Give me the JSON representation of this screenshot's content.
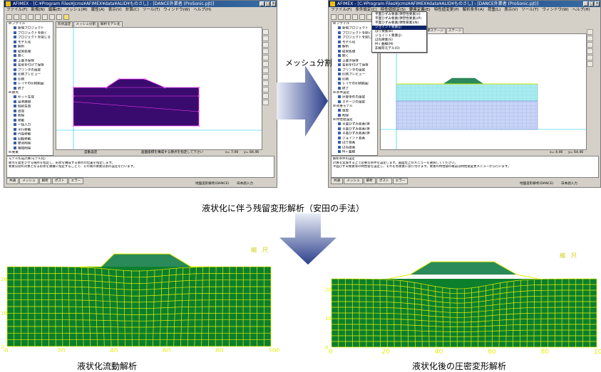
{
  "left_window": {
    "title": "AFIMEX - [C:¥Program Files¥Jcms¥AFIMEX¥data¥ALID¥ものさし] - [DANCE外業者 (ProSonic.pjt)]",
    "menu": [
      "ファイル(F)",
      "新規(N)",
      "編集(E)",
      "メッシュ(M)",
      "属性(A)",
      "表示(V)",
      "計算(C)",
      "ツール(T)",
      "ウィンドウ(W)",
      "ヘルプ(H)"
    ],
    "tabs": [
      "形状設定",
      "メッシュ分割",
      "解析モデル化"
    ],
    "tree": [
      {
        "type": "g",
        "label": "ファイル"
      },
      {
        "type": "it",
        "label": "新規プロジェクト"
      },
      {
        "type": "it",
        "label": "プロジェクトを開く"
      },
      {
        "type": "it",
        "label": "プロジェクトを閉じる"
      },
      {
        "type": "it",
        "label": "モデル化"
      },
      {
        "type": "it",
        "label": "解析"
      },
      {
        "type": "it",
        "label": "結果処理"
      },
      {
        "type": "it",
        "label": "開く"
      },
      {
        "type": "it",
        "label": "上書き保存"
      },
      {
        "type": "it",
        "label": "名前を付けて保存"
      },
      {
        "type": "it",
        "label": "プリンタの設定"
      },
      {
        "type": "it",
        "label": "印刷プレビュー"
      },
      {
        "type": "it",
        "label": "印刷"
      },
      {
        "type": "it",
        "label": "レイヤの印刷範囲"
      },
      {
        "type": "it",
        "label": "終了"
      },
      {
        "type": "g",
        "label": "節点"
      },
      {
        "type": "it",
        "label": "セット生成"
      },
      {
        "type": "it",
        "label": "基準座標"
      },
      {
        "type": "it",
        "label": "個別生成"
      },
      {
        "type": "it",
        "label": "追加"
      },
      {
        "type": "it",
        "label": "削除"
      },
      {
        "type": "it",
        "label": "移動"
      },
      {
        "type": "it",
        "label": "一括入力"
      },
      {
        "type": "it",
        "label": "平行移動"
      },
      {
        "type": "it",
        "label": "円弧移動"
      },
      {
        "type": "it",
        "label": "回転移動"
      },
      {
        "type": "it",
        "label": "節点削除"
      },
      {
        "type": "it",
        "label": "構成削除"
      },
      {
        "type": "g",
        "label": "要素"
      },
      {
        "type": "it",
        "label": "領域生成"
      },
      {
        "type": "it",
        "label": "規則要素"
      },
      {
        "type": "it",
        "label": "円弧生成"
      },
      {
        "type": "it",
        "label": "円弧削除"
      },
      {
        "type": "it",
        "label": "領域削除"
      },
      {
        "type": "it",
        "label": "要素削除"
      }
    ],
    "status_left": "自動設定",
    "status_center": "画面座標を構成する節点を指定して下さい",
    "status_x": "x= 7.06",
    "status_y": "y= 84.46",
    "messages": [
      "モデル作成計算(モデル化)",
      "節点を発生させる場所を指定し、形状を構成する節点の位置を指定します。",
      "要素分割の対象となる形状を順番に指定することで、その後の要素分割の設定を行います。"
    ],
    "bottom_tabs": [
      "共通",
      "メッシュ",
      "解析",
      "ポスト",
      "エラー"
    ],
    "footer_center": "地盤変形解析(DANCE)",
    "footer_right": "日本語入力"
  },
  "right_window": {
    "title": "AFIMEX - [C:¥Program Files¥Jcms¥AFIMEX¥data¥ALID¥ものさし] - [DANCE外業者 (ProSonic.pjt)]",
    "menu": [
      "ファイル(F)",
      "条件設定(C)",
      "特性値設定(S)",
      "要素定義(E)",
      "特性値変更(P)",
      "解析条件(A)",
      "荷重(L)",
      "表示(V)",
      "ツール(T)",
      "ウィンドウ(W)",
      "ヘルプ(H)"
    ],
    "tabs": [
      "節ステージ",
      "ステージ"
    ],
    "dropdown": [
      "平面ひずみ要素(弾塑性要素)(I)",
      "平面ひずみ要素(弾塑性要素)(P)",
      "平面ひずみ要素(弾性要素)(N)",
      "ジョイント要素(J)",
      "はり要素(B)",
      "ジョイント要素(J)",
      "ばね要素(S)",
      "M-r 曲線(M)",
      "非線形モデル(O)"
    ],
    "tree": [
      {
        "type": "g",
        "label": "ファイル"
      },
      {
        "type": "it",
        "label": "新規プロジェクト"
      },
      {
        "type": "it",
        "label": "プロジェクトを開く"
      },
      {
        "type": "it",
        "label": "プロジェクトを閉じる"
      },
      {
        "type": "it",
        "label": "モデル化"
      },
      {
        "type": "it",
        "label": "解析"
      },
      {
        "type": "it",
        "label": "結果処理"
      },
      {
        "type": "it",
        "label": "開く"
      },
      {
        "type": "it",
        "label": "上書き保存"
      },
      {
        "type": "it",
        "label": "名前を付けて保存"
      },
      {
        "type": "it",
        "label": "プリンタの設定"
      },
      {
        "type": "it",
        "label": "印刷プレビュー"
      },
      {
        "type": "it",
        "label": "印刷"
      },
      {
        "type": "it",
        "label": "レイヤの印刷範囲"
      },
      {
        "type": "it",
        "label": "終了"
      },
      {
        "type": "g",
        "label": "条件設定"
      },
      {
        "type": "it",
        "label": "計算条件の設定"
      },
      {
        "type": "it",
        "label": "ステージの設定"
      },
      {
        "type": "g",
        "label": "荷重モデル"
      },
      {
        "type": "it",
        "label": "設定"
      },
      {
        "type": "it",
        "label": "削除"
      },
      {
        "type": "g",
        "label": "特性値設定"
      },
      {
        "type": "it",
        "label": "平面ひずみ要素(弾"
      },
      {
        "type": "it",
        "label": "平面ひずみ要素(弾"
      },
      {
        "type": "it",
        "label": "平面ひずみ要素(弾"
      },
      {
        "type": "it",
        "label": "ジョイント要素"
      },
      {
        "type": "it",
        "label": "はり要素"
      },
      {
        "type": "it",
        "label": "ばね要素"
      },
      {
        "type": "it",
        "label": "M-r 曲線"
      },
      {
        "type": "it",
        "label": "非線形モデル"
      },
      {
        "type": "g",
        "label": "要素定義"
      },
      {
        "type": "it",
        "label": "平面ひずみ要素(弾"
      },
      {
        "type": "it",
        "label": "平面ひずみ要素(弾"
      },
      {
        "type": "it",
        "label": "平面ひずみ要素(弾"
      },
      {
        "type": "it",
        "label": "ジョイント要素"
      }
    ],
    "status_x": "x= 4.46",
    "status_y": "y= 64.46",
    "messages": [
      "解析条件の設定",
      "計算を実施する上で必要な条件を設定します。画面左上のメニューを選択してください。",
      "平面ひずみ要素等の特性値を設定し、それを各要素に割り付けます。要素の特性値の確認は特性値変更メニューから行います。"
    ],
    "bottom_tabs": [
      "共通",
      "メッシュ",
      "解析",
      "ポスト",
      "エラー"
    ],
    "footer_center": "地盤変形解析(DANCE)",
    "footer_right": "日本語入力"
  },
  "captions": {
    "arrow_right": "メッシュ分割",
    "middle": "液状化に伴う残留変形解析（安田の手法）",
    "bottom_left": "液状化流動解析",
    "bottom_right": "液状化後の圧密変形解析"
  },
  "plots": {
    "left": {
      "scale_label": "縮　尺",
      "x_ticks": [
        "0",
        "20",
        "40",
        "60",
        "80",
        "100"
      ],
      "y_ticks": [
        "0",
        "10",
        "20"
      ]
    },
    "right": {
      "scale_label": "縮　尺",
      "x_ticks": [
        "0",
        "20",
        "40",
        "60",
        "80",
        "100"
      ],
      "y_ticks": [
        "0",
        "10",
        "20"
      ]
    }
  },
  "colors": {
    "mesh_green": "#0c7f2c",
    "mesh_line": "#e6f000",
    "embankment": "#2a8a5a",
    "purple": "#3a0b6e",
    "arrow": "#2c3f8c"
  }
}
